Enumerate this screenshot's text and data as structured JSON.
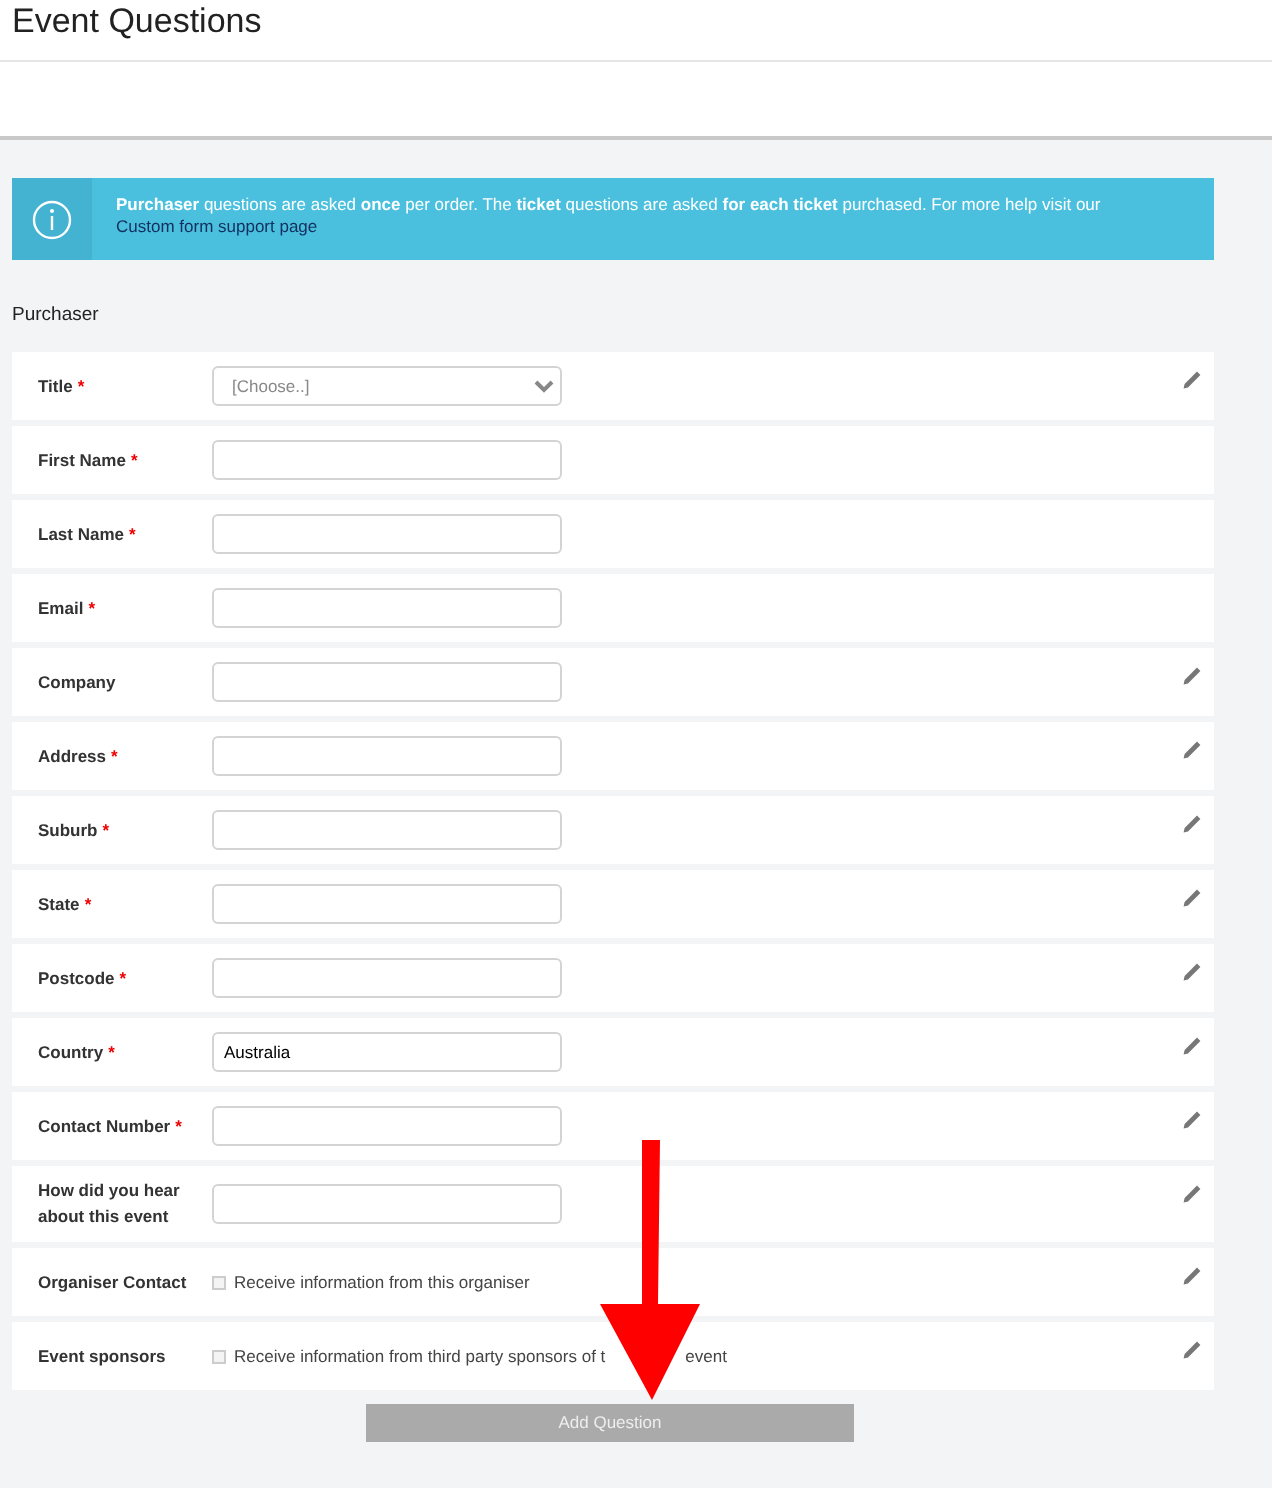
{
  "page_title": "Event Questions",
  "info": {
    "text": "**Purchaser** questions are asked **once** per order. The **ticket** questions are asked **for each ticket** purchased. For more help visit our",
    "link": "Custom form support page"
  },
  "section": "Purchaser",
  "questions": [
    {
      "kind": "select",
      "label": "Title",
      "required_mark": "*",
      "placeholder": "[Choose..]",
      "editable": true
    },
    {
      "kind": "text",
      "label": "First Name",
      "required_mark": "*",
      "editable": false
    },
    {
      "kind": "text",
      "label": "Last Name",
      "required_mark": "*",
      "editable": false
    },
    {
      "kind": "text",
      "label": "Email",
      "required_mark": "*",
      "editable": false
    },
    {
      "kind": "text",
      "label": "Company",
      "editable": true
    },
    {
      "kind": "text",
      "label": "Address",
      "required_mark": "*",
      "editable": true
    },
    {
      "kind": "text",
      "label": "Suburb",
      "required_mark": "*",
      "editable": true
    },
    {
      "kind": "text",
      "label": "State",
      "required_mark": "*",
      "editable": true
    },
    {
      "kind": "text",
      "label": "Postcode",
      "required_mark": "*",
      "editable": true
    },
    {
      "kind": "text",
      "label": "Country",
      "required_mark": "*",
      "value": "Australia",
      "editable": true
    },
    {
      "kind": "text",
      "label": "Contact Number",
      "required_mark": "*",
      "editable": true
    },
    {
      "kind": "text",
      "label": "How did you hear about this event",
      "editable": true
    },
    {
      "kind": "checkbox",
      "label": "Organiser Contact",
      "option": "Receive information from this organiser",
      "checked": false,
      "editable": true
    },
    {
      "kind": "checkbox",
      "label": "Event sponsors",
      "option": "Receive information from third party sponsors of t",
      "option_tail": "event",
      "checked": false,
      "editable": true
    }
  ],
  "add_button": "Add Question"
}
